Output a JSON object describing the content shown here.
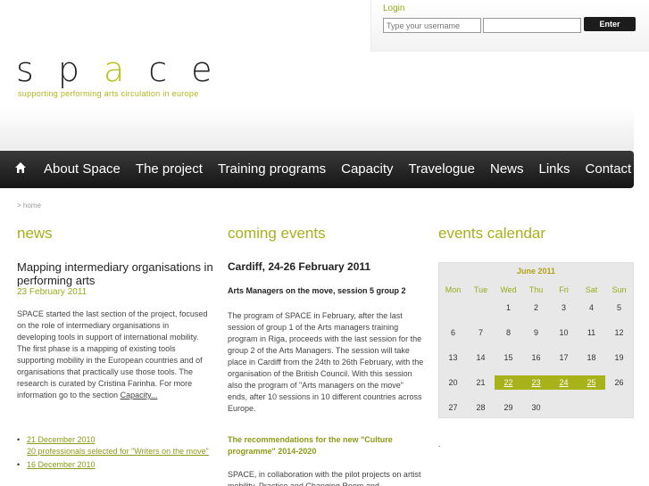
{
  "login": {
    "title": "Login",
    "username_placeholder": "Type your username",
    "password_value": "",
    "enter_label": "Enter"
  },
  "brand": {
    "logo_letters": [
      "s",
      "p",
      "a",
      "c",
      "e"
    ],
    "tagline": "supporting performing arts circulation in europe",
    "accent_color": "#b5c21a"
  },
  "nav": {
    "home_icon": "home-icon",
    "items": [
      "About Space",
      "The project",
      "Training programs",
      "Capacity",
      "Travelogue",
      "News",
      "Links",
      "Contact"
    ]
  },
  "breadcrumb": "> home",
  "news": {
    "heading": "news",
    "title": "Mapping intermediary organisations in performing arts",
    "date": "23 February 2011",
    "body": "SPACE started the last section of the project, focused on the role of intermediary organisations in developing tools in support of international mobility. The first phase is a mapping of existing tools supporting mobility in the European countries and of organisations that practically use those tools. The research is curated by Cristina Farinha. For more information go to the section ",
    "more_link": "Capacity...",
    "list": [
      {
        "date": "21 December 2010",
        "text": "20 professionals selected for \"Writers on the move\""
      },
      {
        "date": "16 December 2010",
        "text": ""
      }
    ]
  },
  "events": {
    "heading": "coming events",
    "title": "Cardiff, 24-26 February 2011",
    "subtitle": "Arts Managers on the move, session 5 group 2",
    "body": "The program of SPACE in February, after the last session of group 1 of the Arts managers training program in Riga, proceeds with the last session for the group 2 of the Arts Managers. The session will take place in Cardiff from the 24th to 26th February, with the organisation of the British Council. With this session also the program of \"Arts managers on the move\" ends, after 10 sessions in 10 different countries across Europe.",
    "subtitle2": "The recommendations for the new \"Culture programme\" 2014-2020",
    "body2": "SPACE, in collaboration with the pilot projects on artist mobility, Practice and Changing Room and"
  },
  "calendar": {
    "heading": "events calendar",
    "month": "June 2011",
    "weekdays": [
      "Mon",
      "Tue",
      "Wed",
      "Thu",
      "Fri",
      "Sat",
      "Sun"
    ],
    "weeks": [
      [
        "",
        "",
        "1",
        "2",
        "3",
        "4",
        "5"
      ],
      [
        "6",
        "7",
        "8",
        "9",
        "10",
        "11",
        "12"
      ],
      [
        "13",
        "14",
        "15",
        "16",
        "17",
        "18",
        "19"
      ],
      [
        "20",
        "21",
        "22",
        "23",
        "24",
        "25",
        "26"
      ],
      [
        "27",
        "28",
        "29",
        "30",
        "",
        "",
        ""
      ]
    ],
    "highlighted": [
      "22",
      "23",
      "24",
      "25"
    ],
    "footer_dot": "."
  }
}
